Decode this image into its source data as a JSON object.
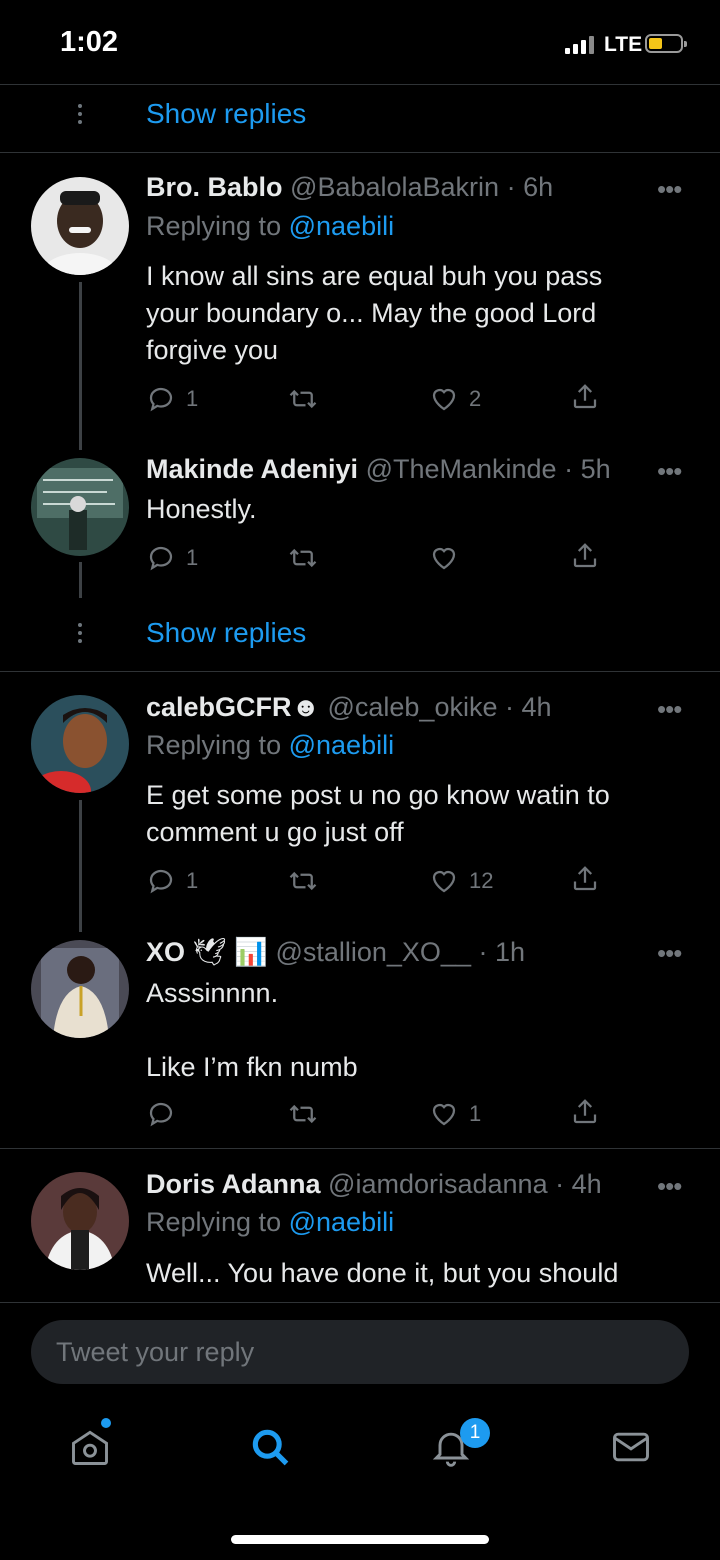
{
  "status_bar": {
    "time": "1:02",
    "network": "LTE"
  },
  "show_replies_label": "Show replies",
  "compose": {
    "placeholder": "Tweet your reply"
  },
  "notifications_badge": "1",
  "tweets": [
    {
      "name": "Bro. Bablo",
      "handle": "@BabalolaBakrin",
      "time": "· 6h",
      "replying_prefix": "Replying to",
      "replying_to": "@naebili",
      "text": [
        "I know all sins are equal buh you pass",
        "your boundary o... May the good Lord",
        "forgive you"
      ],
      "replies": "1",
      "retweets": "",
      "likes": "2"
    },
    {
      "name": "Makinde Adeniyi",
      "handle": "@TheMankinde",
      "time": "· 5h",
      "text": [
        "Honestly."
      ],
      "replies": "1",
      "retweets": "",
      "likes": ""
    },
    {
      "name": "calebGCFR☻",
      "handle": "@caleb_okike",
      "time": "· 4h",
      "replying_prefix": "Replying to",
      "replying_to": "@naebili",
      "text": [
        "E get some post u no go know watin to",
        "comment u go just off"
      ],
      "replies": "1",
      "retweets": "",
      "likes": "12"
    },
    {
      "name": "XO",
      "name_emojis": "🕊 📊",
      "handle": "@stallion_XO__",
      "time": "· 1h",
      "text": [
        "Asssinnnn.",
        "",
        "Like I’m fkn numb"
      ],
      "replies": "",
      "retweets": "",
      "likes": "1"
    },
    {
      "name": "Doris Adanna",
      "handle": "@iamdorisadanna",
      "time": "· 4h",
      "replying_prefix": "Replying to",
      "replying_to": "@naebili",
      "text": [
        "Well... You have done it, but you should"
      ],
      "replies": "",
      "retweets": "",
      "likes": ""
    }
  ],
  "colors": {
    "accent": "#1d9bf0",
    "background": "#000000",
    "muted": "#71767b"
  }
}
